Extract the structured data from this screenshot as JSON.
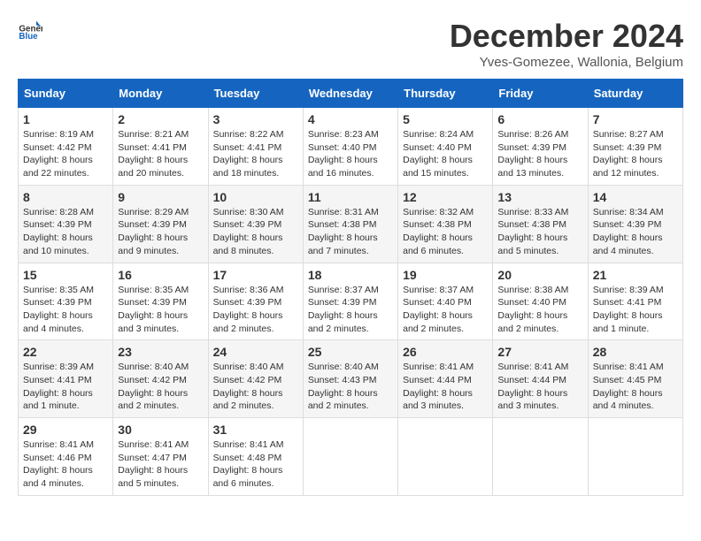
{
  "header": {
    "logo_general": "General",
    "logo_blue": "Blue",
    "title": "December 2024",
    "location": "Yves-Gomezee, Wallonia, Belgium"
  },
  "days_of_week": [
    "Sunday",
    "Monday",
    "Tuesday",
    "Wednesday",
    "Thursday",
    "Friday",
    "Saturday"
  ],
  "weeks": [
    [
      {
        "day": "1",
        "sunrise": "8:19 AM",
        "sunset": "4:42 PM",
        "daylight": "8 hours and 22 minutes."
      },
      {
        "day": "2",
        "sunrise": "8:21 AM",
        "sunset": "4:41 PM",
        "daylight": "8 hours and 20 minutes."
      },
      {
        "day": "3",
        "sunrise": "8:22 AM",
        "sunset": "4:41 PM",
        "daylight": "8 hours and 18 minutes."
      },
      {
        "day": "4",
        "sunrise": "8:23 AM",
        "sunset": "4:40 PM",
        "daylight": "8 hours and 16 minutes."
      },
      {
        "day": "5",
        "sunrise": "8:24 AM",
        "sunset": "4:40 PM",
        "daylight": "8 hours and 15 minutes."
      },
      {
        "day": "6",
        "sunrise": "8:26 AM",
        "sunset": "4:39 PM",
        "daylight": "8 hours and 13 minutes."
      },
      {
        "day": "7",
        "sunrise": "8:27 AM",
        "sunset": "4:39 PM",
        "daylight": "8 hours and 12 minutes."
      }
    ],
    [
      {
        "day": "8",
        "sunrise": "8:28 AM",
        "sunset": "4:39 PM",
        "daylight": "8 hours and 10 minutes."
      },
      {
        "day": "9",
        "sunrise": "8:29 AM",
        "sunset": "4:39 PM",
        "daylight": "8 hours and 9 minutes."
      },
      {
        "day": "10",
        "sunrise": "8:30 AM",
        "sunset": "4:39 PM",
        "daylight": "8 hours and 8 minutes."
      },
      {
        "day": "11",
        "sunrise": "8:31 AM",
        "sunset": "4:38 PM",
        "daylight": "8 hours and 7 minutes."
      },
      {
        "day": "12",
        "sunrise": "8:32 AM",
        "sunset": "4:38 PM",
        "daylight": "8 hours and 6 minutes."
      },
      {
        "day": "13",
        "sunrise": "8:33 AM",
        "sunset": "4:38 PM",
        "daylight": "8 hours and 5 minutes."
      },
      {
        "day": "14",
        "sunrise": "8:34 AM",
        "sunset": "4:39 PM",
        "daylight": "8 hours and 4 minutes."
      }
    ],
    [
      {
        "day": "15",
        "sunrise": "8:35 AM",
        "sunset": "4:39 PM",
        "daylight": "8 hours and 4 minutes."
      },
      {
        "day": "16",
        "sunrise": "8:35 AM",
        "sunset": "4:39 PM",
        "daylight": "8 hours and 3 minutes."
      },
      {
        "day": "17",
        "sunrise": "8:36 AM",
        "sunset": "4:39 PM",
        "daylight": "8 hours and 2 minutes."
      },
      {
        "day": "18",
        "sunrise": "8:37 AM",
        "sunset": "4:39 PM",
        "daylight": "8 hours and 2 minutes."
      },
      {
        "day": "19",
        "sunrise": "8:37 AM",
        "sunset": "4:40 PM",
        "daylight": "8 hours and 2 minutes."
      },
      {
        "day": "20",
        "sunrise": "8:38 AM",
        "sunset": "4:40 PM",
        "daylight": "8 hours and 2 minutes."
      },
      {
        "day": "21",
        "sunrise": "8:39 AM",
        "sunset": "4:41 PM",
        "daylight": "8 hours and 1 minute."
      }
    ],
    [
      {
        "day": "22",
        "sunrise": "8:39 AM",
        "sunset": "4:41 PM",
        "daylight": "8 hours and 1 minute."
      },
      {
        "day": "23",
        "sunrise": "8:40 AM",
        "sunset": "4:42 PM",
        "daylight": "8 hours and 2 minutes."
      },
      {
        "day": "24",
        "sunrise": "8:40 AM",
        "sunset": "4:42 PM",
        "daylight": "8 hours and 2 minutes."
      },
      {
        "day": "25",
        "sunrise": "8:40 AM",
        "sunset": "4:43 PM",
        "daylight": "8 hours and 2 minutes."
      },
      {
        "day": "26",
        "sunrise": "8:41 AM",
        "sunset": "4:44 PM",
        "daylight": "8 hours and 3 minutes."
      },
      {
        "day": "27",
        "sunrise": "8:41 AM",
        "sunset": "4:44 PM",
        "daylight": "8 hours and 3 minutes."
      },
      {
        "day": "28",
        "sunrise": "8:41 AM",
        "sunset": "4:45 PM",
        "daylight": "8 hours and 4 minutes."
      }
    ],
    [
      {
        "day": "29",
        "sunrise": "8:41 AM",
        "sunset": "4:46 PM",
        "daylight": "8 hours and 4 minutes."
      },
      {
        "day": "30",
        "sunrise": "8:41 AM",
        "sunset": "4:47 PM",
        "daylight": "8 hours and 5 minutes."
      },
      {
        "day": "31",
        "sunrise": "8:41 AM",
        "sunset": "4:48 PM",
        "daylight": "8 hours and 6 minutes."
      },
      null,
      null,
      null,
      null
    ]
  ],
  "labels": {
    "sunrise": "Sunrise:",
    "sunset": "Sunset:",
    "daylight": "Daylight:"
  }
}
